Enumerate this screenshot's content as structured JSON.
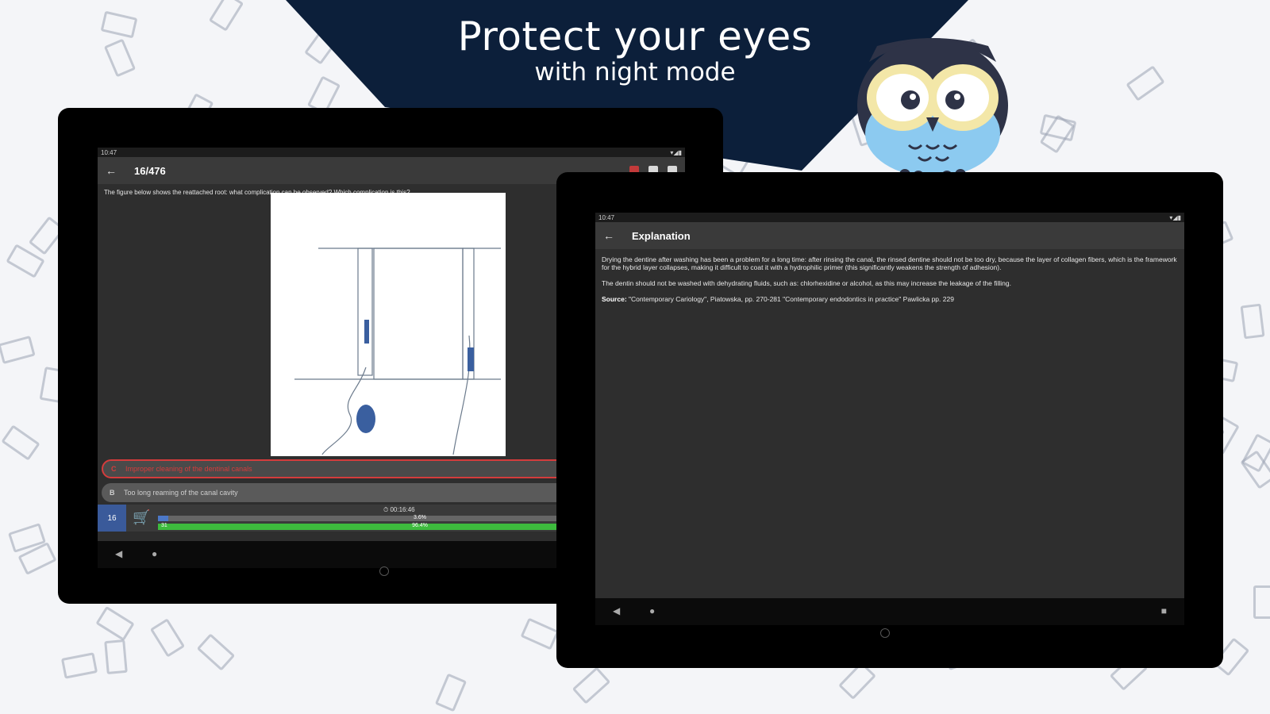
{
  "banner": {
    "headline": "Protect your eyes",
    "subheadline": "with night mode",
    "color": "#0c1f3a"
  },
  "left_tablet": {
    "status_time": "10:47",
    "appbar_title": "16/476",
    "question": "The figure below shows the reattached root: what complication can be observed? Which complication is this?",
    "answers": [
      {
        "letter": "C",
        "text": "Improper cleaning of the dentinal canals",
        "state": "wrong"
      },
      {
        "letter": "B",
        "text": "Too long reaming of the canal cavity",
        "state": "neutral"
      }
    ],
    "home_label": "16",
    "timer": "00:16:46",
    "progress_blue": 0.02,
    "progress_blue_label": "3.6%",
    "progress_green": 1.0,
    "progress_green_label": "96.4%",
    "progress_green_left": "31"
  },
  "right_tablet": {
    "status_time": "10:47",
    "appbar_title": "Explanation",
    "paragraphs": [
      "Drying the dentine after washing has been a problem for a long time: after rinsing the canal, the rinsed dentine should not be too dry, because the layer of collagen fibers, which is the framework for the hybrid layer collapses, making it difficult to coat it with a hydrophilic primer (this significantly weakens the strength of adhesion).",
      "The dentin should not be washed with dehydrating fluids, such as: chlorhexidine or alcohol, as this may increase the leakage of the filling."
    ],
    "source_label": "Source:",
    "source_text": "\"Contemporary Cariology\", Piatowska, pp. 270-281 \"Contemporary endodontics in practice\" Pawlicka pp. 229"
  }
}
